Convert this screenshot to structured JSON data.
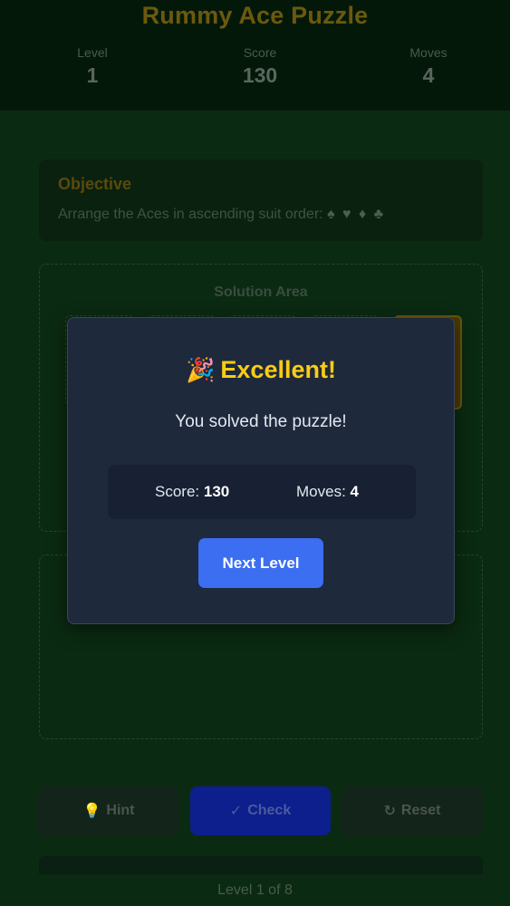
{
  "header": {
    "title": "Rummy Ace Puzzle",
    "stats": [
      {
        "label": "Level",
        "value": "1"
      },
      {
        "label": "Score",
        "value": "130"
      },
      {
        "label": "Moves",
        "value": "4"
      }
    ]
  },
  "objective": {
    "title": "Objective",
    "text": "Arrange the Aces in ascending suit order:",
    "suits": "♠ ♥ ♦ ♣"
  },
  "solution": {
    "label": "Solution Area"
  },
  "buttons": {
    "hint": {
      "icon": "lightbulb-icon",
      "glyph": "💡",
      "label": "Hint"
    },
    "check": {
      "icon": "check-icon",
      "glyph": "✓",
      "label": "Check"
    },
    "reset": {
      "icon": "reset-icon",
      "glyph": "↻",
      "label": "Reset"
    }
  },
  "footer": {
    "text": "Level 1 of 8"
  },
  "modal": {
    "icon": "party-popper-icon",
    "icon_glyph": "🎉",
    "title": "Excellent!",
    "message": "You solved the puzzle!",
    "score_label": "Score:",
    "score_value": "130",
    "moves_label": "Moves:",
    "moves_value": "4",
    "next_label": "Next Level"
  },
  "colors": {
    "background": "#0b2a12",
    "accent_gold": "#facc15",
    "primary_blue": "#3b6ef0",
    "modal_bg": "#1e293b"
  }
}
